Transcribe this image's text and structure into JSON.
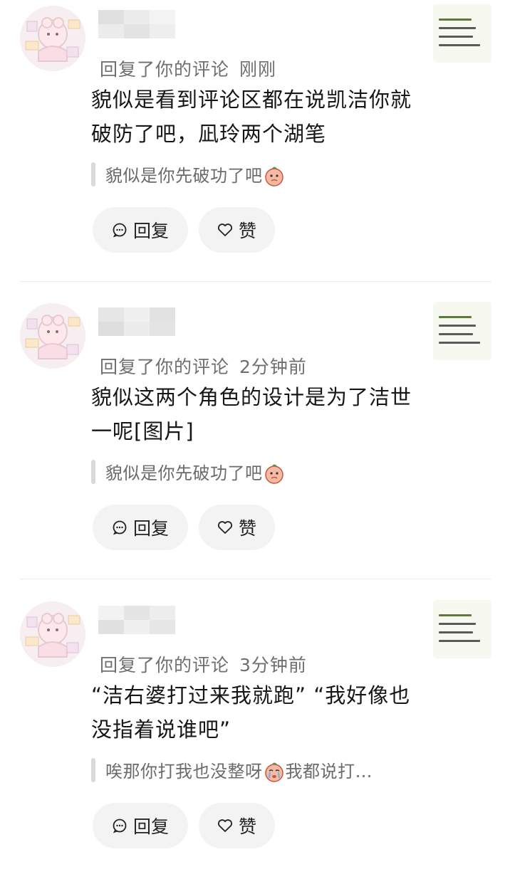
{
  "comments": [
    {
      "action": "回复了你的评论",
      "time": "刚刚",
      "content": "貌似是看到评论区都在说凯洁你就破防了吧，凪玲两个湖笔",
      "quote_before": "貌似是你先破功了吧",
      "quote_after": "",
      "reply_label": "回复",
      "like_label": "赞"
    },
    {
      "action": "回复了你的评论",
      "time": "2分钟前",
      "content": "貌似这两个角色的设计是为了洁世一呢[图片]",
      "quote_before": "貌似是你先破功了吧",
      "quote_after": "",
      "reply_label": "回复",
      "like_label": "赞"
    },
    {
      "action": "回复了你的评论",
      "time": "3分钟前",
      "content": "“洁右婆打过来我就跑” “我好像也没指着说谁吧”",
      "quote_before": "唉那你打我也没整呀",
      "quote_after": "我都说打…",
      "reply_label": "回复",
      "like_label": "赞"
    }
  ]
}
